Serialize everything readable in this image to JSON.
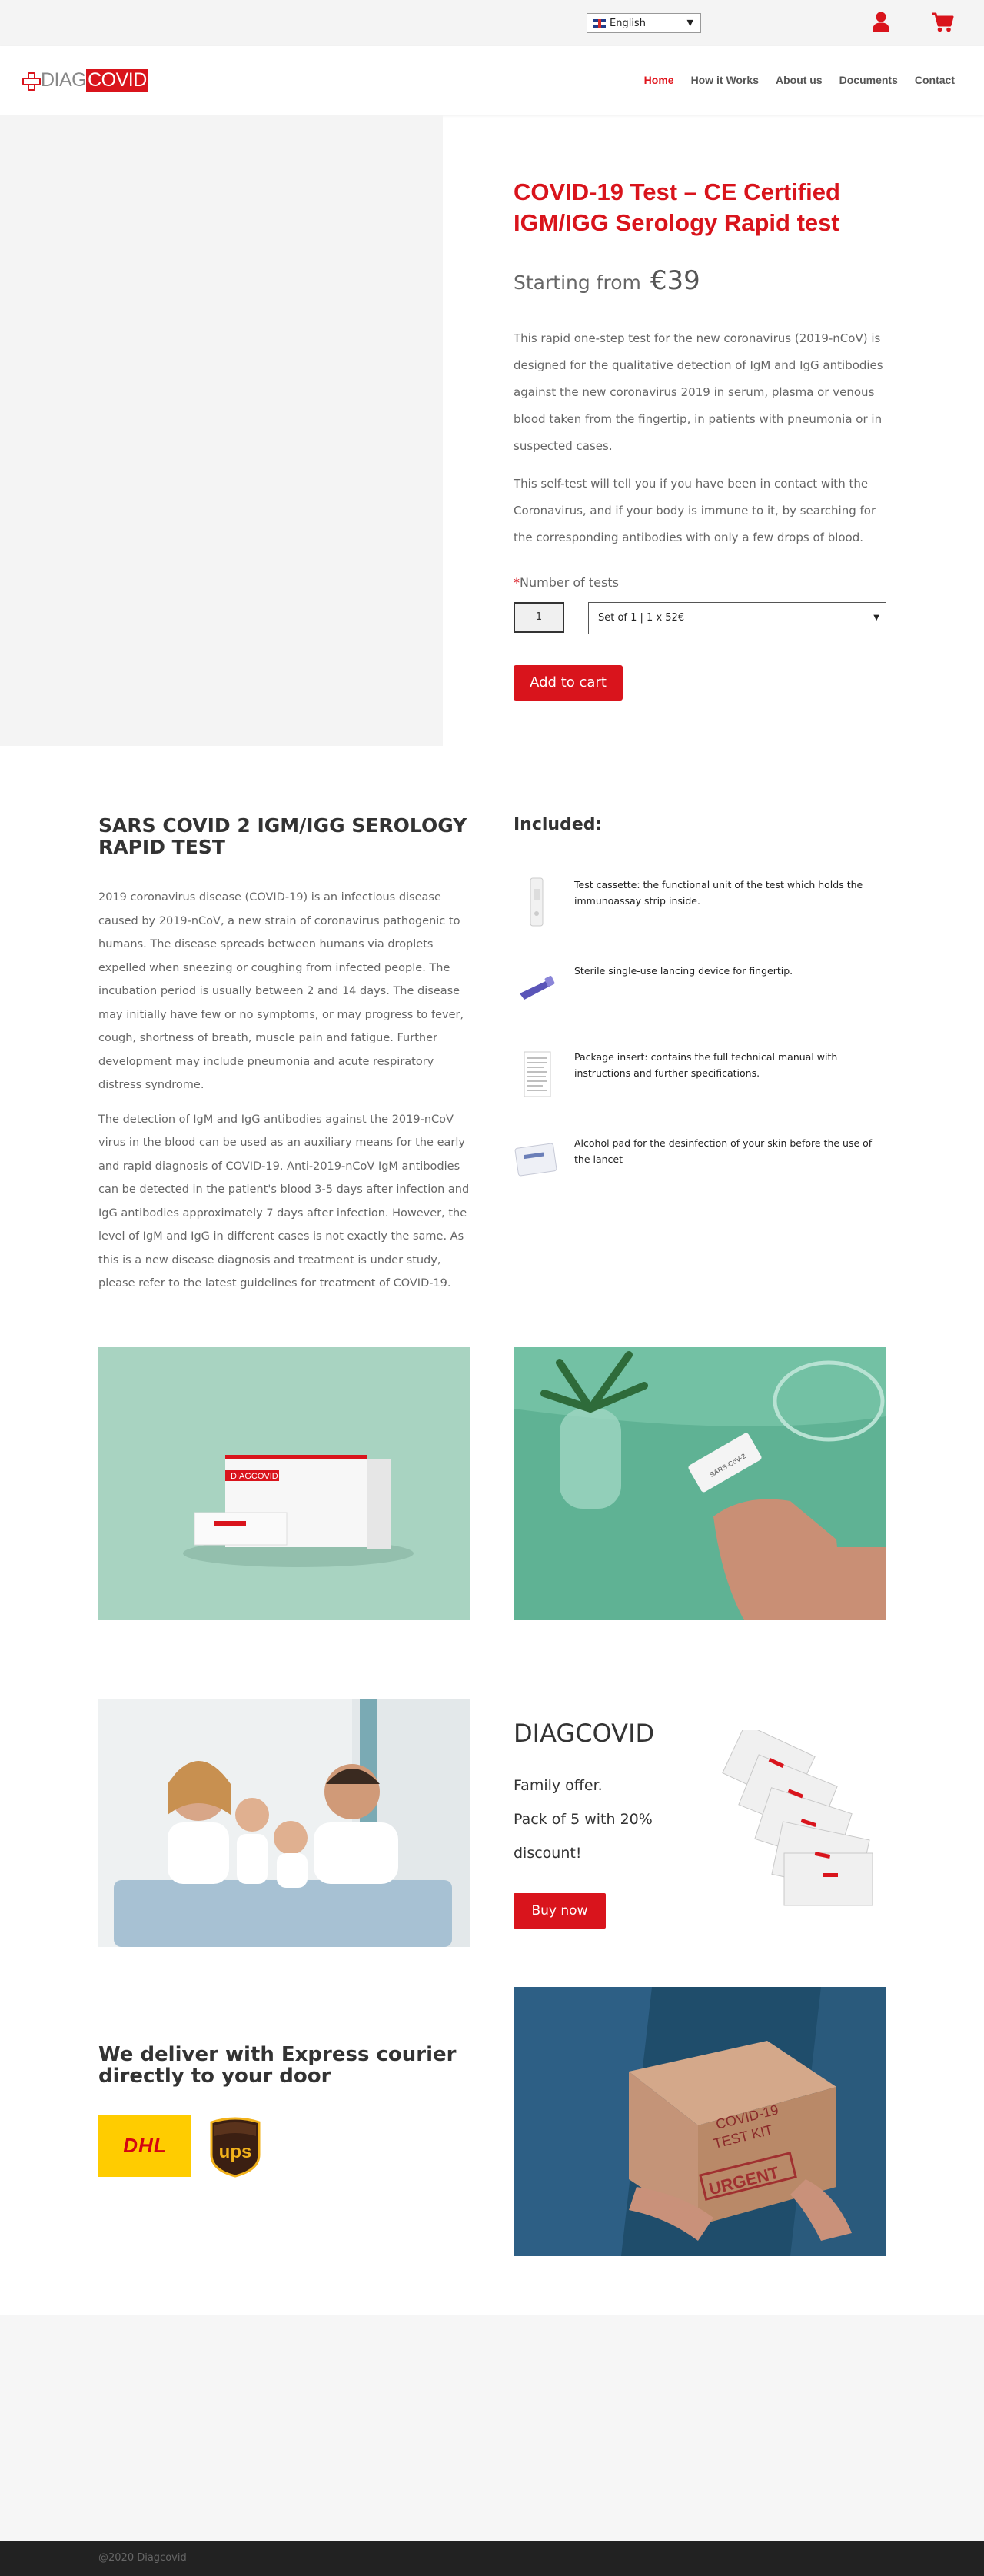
{
  "topbar": {
    "language": "English"
  },
  "header": {
    "logo_diag": "DIAG",
    "logo_covid": "COVID",
    "nav": [
      "Home",
      "How it Works",
      "About us",
      "Documents",
      "Contact"
    ]
  },
  "product": {
    "title": "COVID-19 Test – CE Certified IGM/IGG Serology Rapid test",
    "price_prefix": "Starting from",
    "price_amount": "€39",
    "description": [
      "This rapid one-step test for the new coronavirus (2019-nCoV) is designed for the qualitative detection of IgM and IgG antibodies against the new coronavirus 2019 in serum, plasma or venous blood taken from the fingertip, in patients with pneumonia or in suspected cases.",
      "This self-test will tell you if you have been in contact with the Coronavirus, and if your body is immune to it, by searching for the corresponding antibodies with only a few drops of blood."
    ],
    "required_marker": "*",
    "quantity_label": "Number of tests",
    "quantity_value": "1",
    "set_option": "Set of 1 | 1 x 52€",
    "add_to_cart": "Add to cart"
  },
  "info": {
    "title": "SARS COVID 2 IGM/IGG SEROLOGY RAPID TEST",
    "paragraphs": [
      "2019 coronavirus disease (COVID-19) is an infectious disease caused by 2019-nCoV, a new strain of coronavirus pathogenic to humans. The disease spreads between humans via droplets expelled when sneezing or coughing from infected people. The incubation period is usually between 2 and 14 days. The disease may initially have few or no symptoms, or may progress to fever, cough, shortness of breath, muscle pain and fatigue. Further development may include pneumonia and acute respiratory distress syndrome.",
      "The detection of IgM and IgG antibodies against the 2019-nCoV virus in the blood can be used as an auxiliary means for the early and rapid diagnosis of COVID-19. Anti-2019-nCoV IgM antibodies can be detected in the patient's blood 3-5 days after infection and IgG antibodies approximately 7 days after infection. However, the level of IgM and IgG in different cases is not exactly the same. As this is a new disease diagnosis and treatment is under study, please refer to the latest guidelines for treatment of COVID-19."
    ]
  },
  "included": {
    "title": "Included:",
    "items": [
      "Test cassette: the functional unit of the test which holds the immunoassay strip inside.",
      "Sterile single-use lancing device for fingertip.",
      "Package insert: contains the full technical manual with instructions and further specifications.",
      "Alcohol pad for the desinfection of your skin before the use of the lancet"
    ]
  },
  "photos": {
    "box_brand": "DIAGCOVID",
    "cassette_label": "SARS-CoV-2"
  },
  "offer": {
    "title": "DIAGCOVID",
    "lines": [
      "Family offer.",
      "Pack of 5 with 20%",
      "discount!"
    ],
    "buy_now": "Buy now"
  },
  "delivery": {
    "title": "We deliver with Express courier directly to your door",
    "dhl": "DHL",
    "ups": "ups",
    "box_text_1": "COVID-19",
    "box_text_2": "TEST KIT",
    "box_text_3": "URGENT"
  },
  "footer": {
    "copyright": "@2020 Diagcovid"
  },
  "colors": {
    "brand_red": "#d9141c",
    "footer_dark": "#222222"
  }
}
